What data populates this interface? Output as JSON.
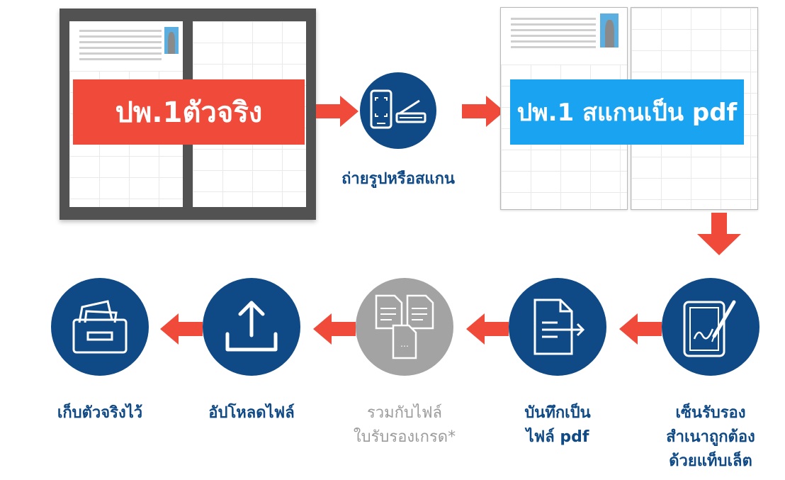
{
  "top_row": {
    "original_label": "ปพ.1ตัวจริง",
    "scan_step_label": "ถ่ายรูปหรือสแกน",
    "scanned_label": "ปพ.1 สแกนเป็น pdf"
  },
  "bottom_row": {
    "sign_label_1": "เซ็นรับรอง",
    "sign_label_2": "สำเนาถูกต้อง",
    "sign_label_3": "ด้วยแท็บเล็ต",
    "save_label_1": "บันทึกเป็น",
    "save_label_2": "ไฟล์ pdf",
    "merge_label_1": "รวมกับไฟล์",
    "merge_label_2": "ใบรับรองเกรด*",
    "upload_label": "อัปโหลดไฟล์",
    "keep_label": "เก็บตัวจริงไว้"
  },
  "icons": {
    "scan_step": "phone-and-scanner-icon",
    "sign": "tablet-pen-icon",
    "save_pdf": "document-export-icon",
    "merge": "merge-files-icon",
    "upload": "upload-icon",
    "keep": "file-cabinet-icon",
    "arrow": "red-arrow-icon"
  },
  "colors": {
    "navy": "#0f4a86",
    "red": "#f04a3a",
    "blue": "#1aa3f0",
    "grey": "#a3a3a3",
    "dark_frame": "#525252"
  }
}
